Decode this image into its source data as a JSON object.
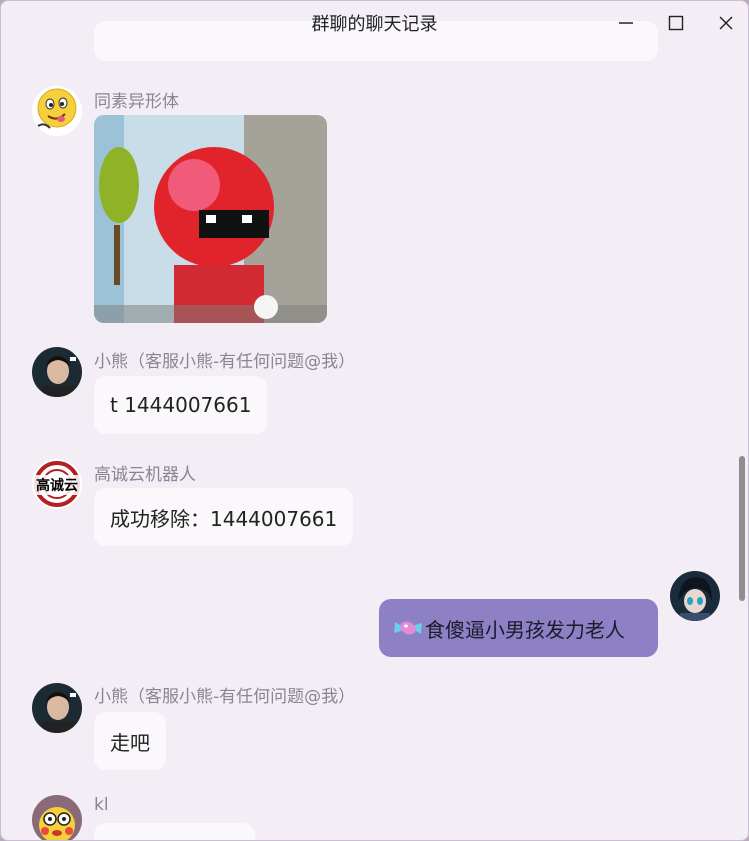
{
  "window": {
    "title": "群聊的聊天记录"
  },
  "messages": [
    {
      "sender": "同素异形体",
      "type": "image",
      "image_desc": "pixel-art sticker"
    },
    {
      "sender": "小熊（客服小熊-有任何问题@我）",
      "text": "t 1444007661"
    },
    {
      "sender": "高诚云机器人",
      "avatar_text": "高诚云",
      "text": "成功移除：1444007661"
    },
    {
      "sender": "self",
      "text": "食傻逼小男孩发力老人",
      "icon": "candy-icon"
    },
    {
      "sender": "小熊（客服小熊-有任何问题@我）",
      "text": "走吧"
    },
    {
      "sender": "kl",
      "text": ""
    }
  ],
  "colors": {
    "window_bg": "#f3eef6",
    "bubble_bg": "#fbf8fc",
    "self_bubble_bg": "#8e80c4",
    "name_text": "#8a858f"
  }
}
